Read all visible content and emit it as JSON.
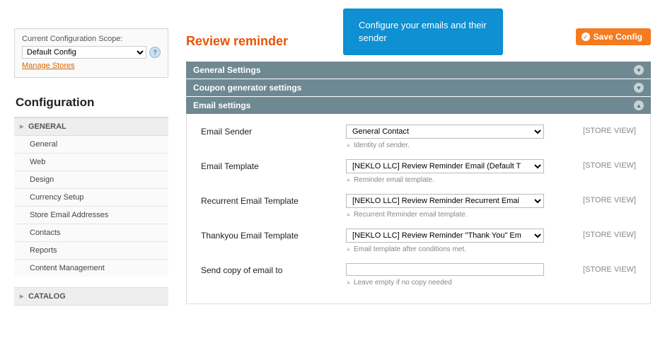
{
  "sidebar": {
    "scope_label": "Current Configuration Scope:",
    "scope_value": "Default Config",
    "manage_stores": "Manage Stores",
    "config_heading": "Configuration",
    "sections": [
      {
        "header": "GENERAL",
        "items": [
          "General",
          "Web",
          "Design",
          "Currency Setup",
          "Store Email Addresses",
          "Contacts",
          "Reports",
          "Content Management"
        ]
      },
      {
        "header": "CATALOG",
        "items": []
      }
    ]
  },
  "page": {
    "title": "Review reminder",
    "save_label": "Save Config",
    "tooltip": "Configure your emails and their sender"
  },
  "fieldsets": {
    "general": "General Settings",
    "coupon": "Coupon generator settings",
    "email": "Email settings"
  },
  "email_fields": {
    "sender": {
      "label": "Email Sender",
      "value": "General Contact",
      "hint": "Identity of sender.",
      "scope": "[STORE VIEW]"
    },
    "template": {
      "label": "Email Template",
      "value": "[NEKLO LLC] Review Reminder Email (Default T",
      "hint": "Reminder email template.",
      "scope": "[STORE VIEW]"
    },
    "recurrent": {
      "label": "Recurrent Email Template",
      "value": "[NEKLO LLC] Review Reminder Recurrent Emai",
      "hint": "Recurrent Reminder email template.",
      "scope": "[STORE VIEW]"
    },
    "thankyou": {
      "label": "Thankyou Email Template",
      "value": "[NEKLO LLC] Review Reminder \"Thank You\" Em",
      "hint": "Email template after conditions met.",
      "scope": "[STORE VIEW]"
    },
    "copy_to": {
      "label": "Send copy of email to",
      "value": "",
      "hint": "Leave empty if no copy needed",
      "scope": "[STORE VIEW]"
    }
  }
}
